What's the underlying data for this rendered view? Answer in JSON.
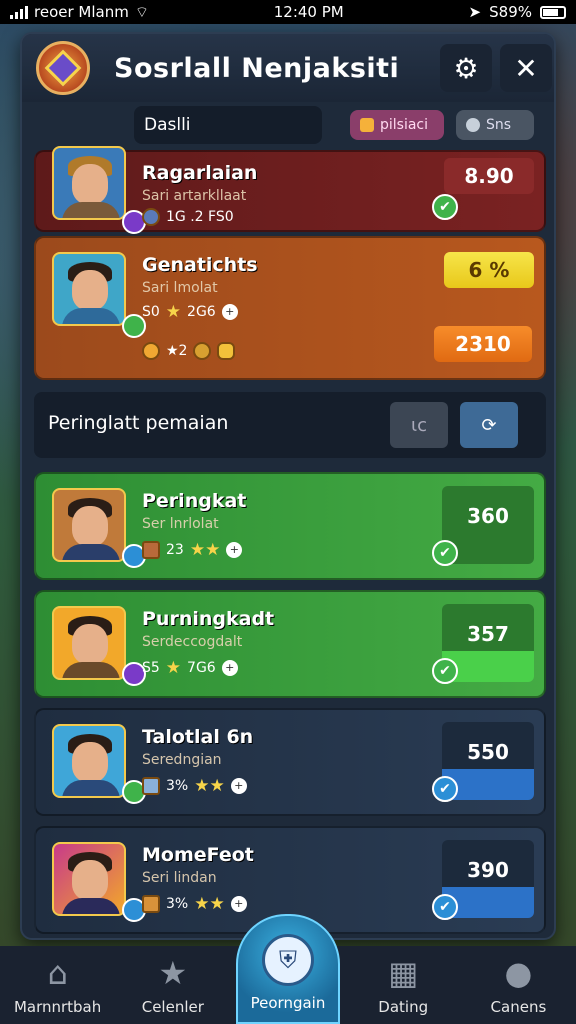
{
  "status": {
    "carrier": "reoer Mlanm",
    "time": "12:40 PM",
    "battery": "S89%"
  },
  "header": {
    "title": "Sosrlall Nenjaksiti"
  },
  "tabs": {
    "main": "Daslli",
    "pill_a": "pilsiaci",
    "pill_b": "Sns"
  },
  "section": {
    "title": "Peringlatt pemaian",
    "btn_a": "ιc"
  },
  "top_cards": [
    {
      "name": "Ragarlaian",
      "sub": "Sari artarkllaat",
      "stats": "1G  .2  FS0",
      "score": "8.90",
      "color": "#6e1f1f",
      "score_bg": "#8a2a2a"
    },
    {
      "name": "Genatichts",
      "sub": "Sari lmolat",
      "stats": "S0",
      "stats2": "2G6",
      "row2": "★2",
      "score": "6 %",
      "score2": "2310",
      "color": "#b4521f"
    }
  ],
  "ranked_cards": [
    {
      "name": "Peringkat",
      "sub": "Ser lnrlolat",
      "stat_a": "23",
      "score": "360",
      "color": "#3aa23c"
    },
    {
      "name": "Purningkadt",
      "sub": "Serdeccogdalt",
      "stat_a": "S5",
      "stat_b": "7G6",
      "score": "357",
      "color": "#3aa23c"
    },
    {
      "name": "Talotlal 6n",
      "sub": "Seredngian",
      "stat_a": "3%",
      "score": "550",
      "color": "#243448"
    },
    {
      "name": "MomeFeot",
      "sub": "Seri lindan",
      "stat_a": "3%",
      "score": "390",
      "color": "#243448"
    }
  ],
  "bottom_nav": [
    {
      "label": "Marnnrtbah",
      "icon": "home-icon"
    },
    {
      "label": "Celenler",
      "icon": "star-icon"
    },
    {
      "label": "Peorngain",
      "icon": "shield-icon"
    },
    {
      "label": "Dating",
      "icon": "grid-icon"
    },
    {
      "label": "Canens",
      "icon": "user-icon"
    }
  ]
}
